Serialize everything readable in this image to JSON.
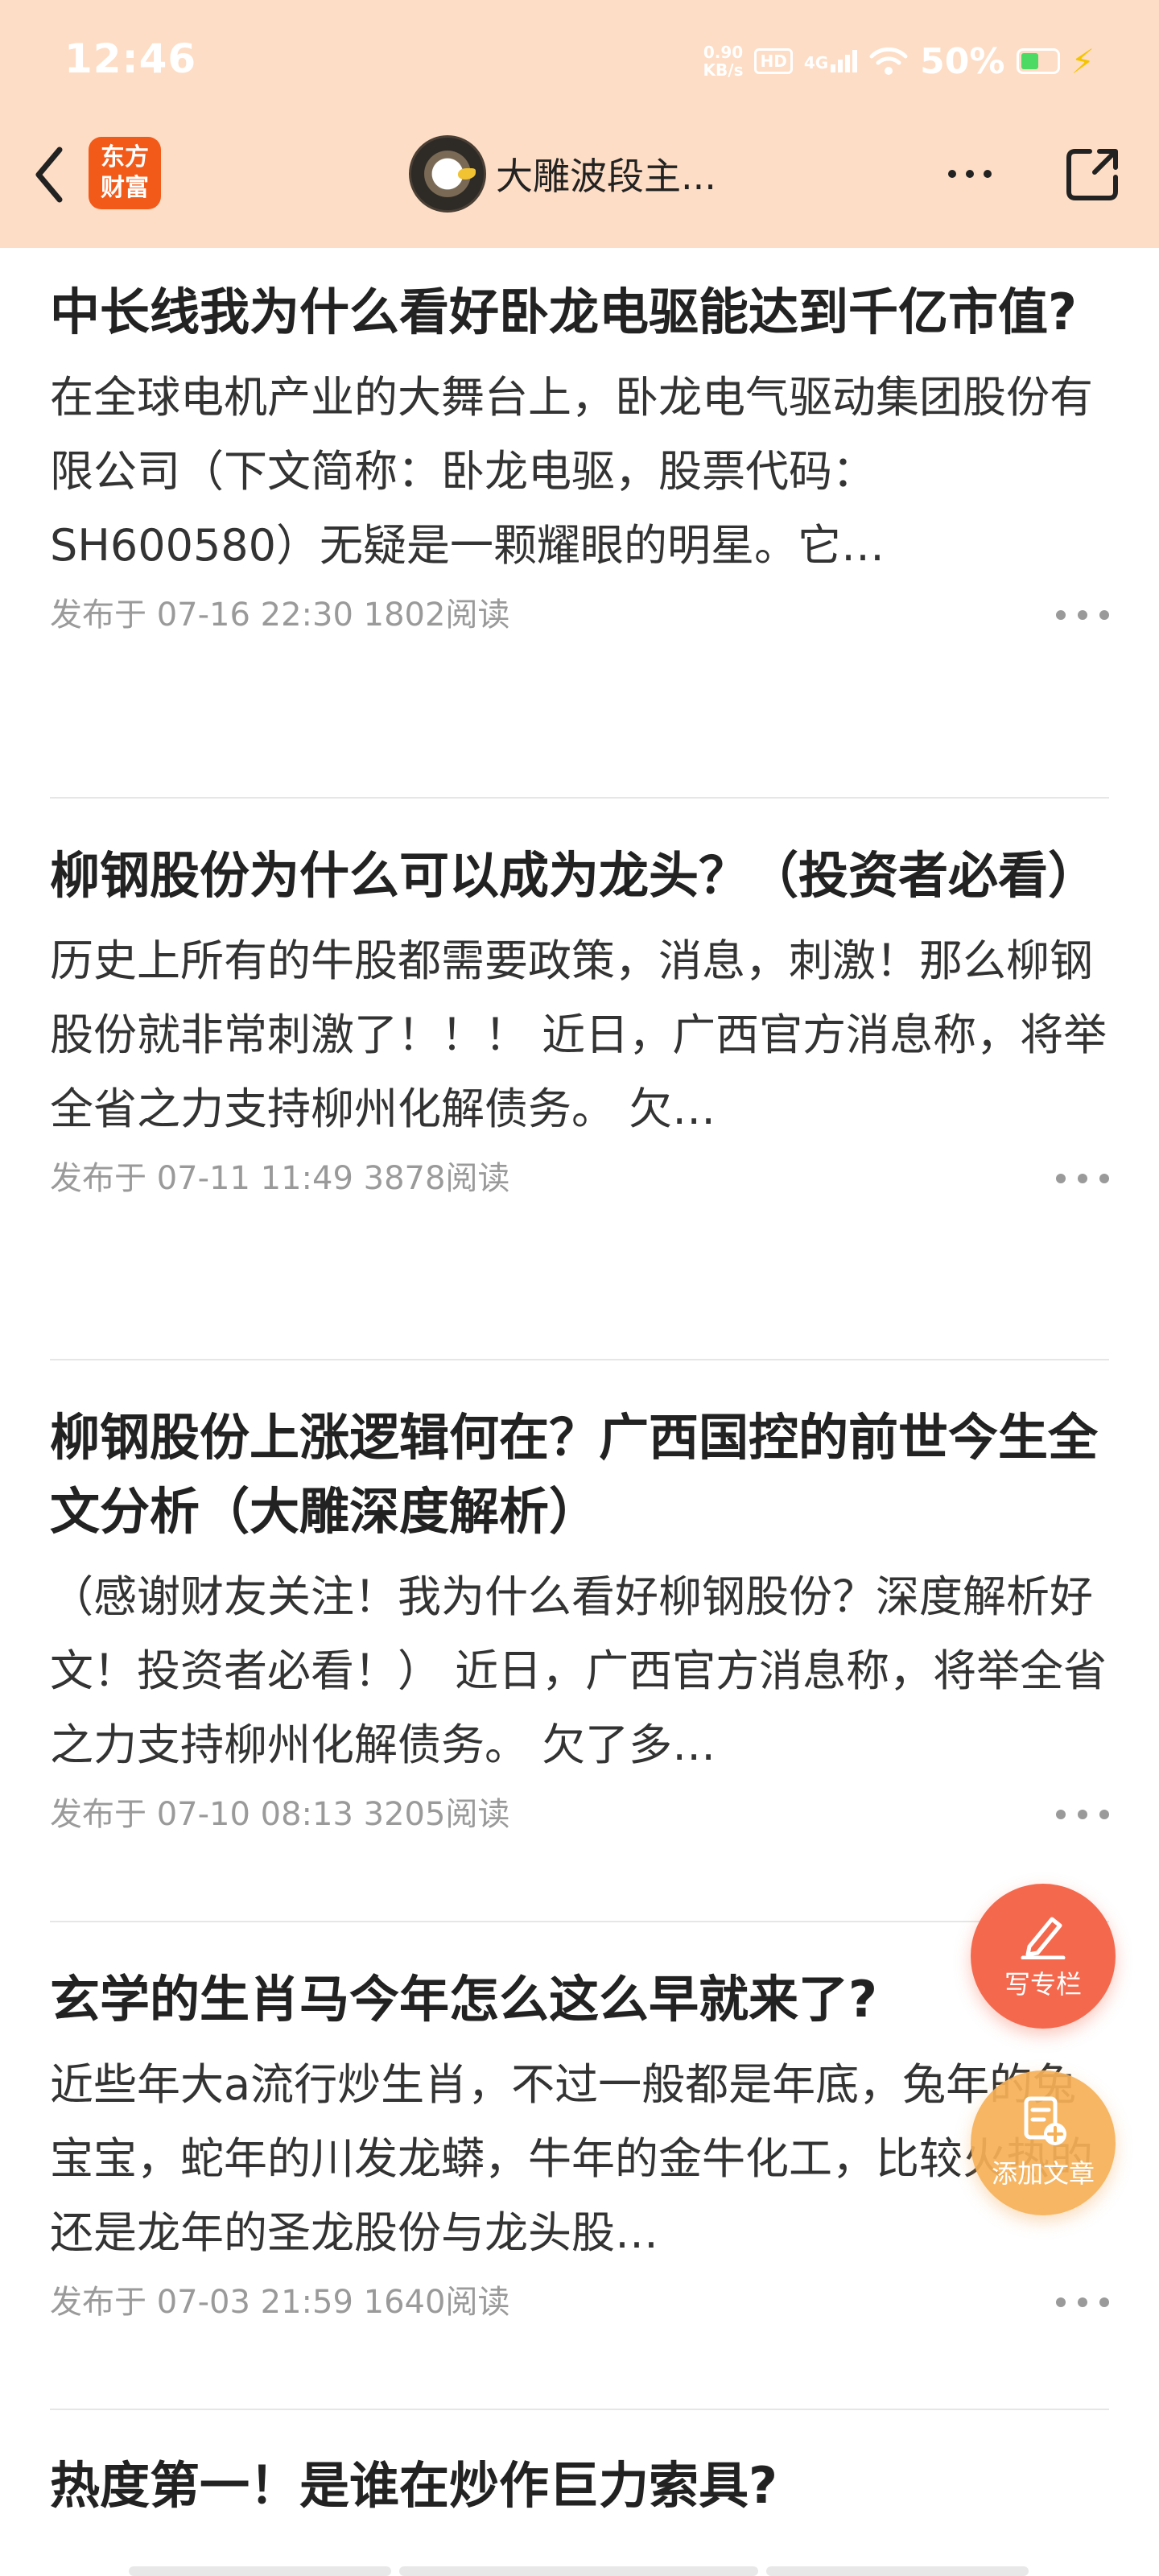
{
  "status_bar": {
    "time": "12:46",
    "net_speed_value": "0.90",
    "net_speed_unit": "KB/s",
    "hd_label": "HD",
    "network_label": "4G",
    "battery_percent": "50%"
  },
  "nav": {
    "logo_line1": "东方",
    "logo_line2": "财富",
    "author_name": "大雕波段主..."
  },
  "articles": [
    {
      "title": "中长线我为什么看好卧龙电驱能达到千亿市值?",
      "excerpt": "在全球电机产业的大舞台上，卧龙电气驱动集团股份有限公司（下文简称：卧龙电驱，股票代码：SH600580）无疑是一颗耀眼的明星。它…",
      "meta": "发布于 07-16 22:30 1802阅读"
    },
    {
      "title": "柳钢股份为什么可以成为龙头？（投资者必看）",
      "excerpt": "历史上所有的牛股都需要政策，消息，刺激！那么柳钢股份就非常刺激了！！！ 近日，广西官方消息称，将举全省之力支持柳州化解债务。 欠…",
      "meta": "发布于 07-11 11:49 3878阅读"
    },
    {
      "title": "柳钢股份上涨逻辑何在？广西国控的前世今生全文分析（大雕深度解析）",
      "excerpt": "（感谢财友关注！我为什么看好柳钢股份？深度解析好文！投资者必看！） 近日，广西官方消息称，将举全省之力支持柳州化解债务。 欠了多…",
      "meta": "发布于 07-10 08:13 3205阅读"
    },
    {
      "title": "玄学的生肖马今年怎么这么早就来了?",
      "excerpt": "近些年大a流行炒生肖，不过一般都是年底，兔年的兔宝宝，蛇年的川发龙蟒，牛年的金牛化工，比较火热的还是龙年的圣龙股份与龙头股…",
      "meta": "发布于 07-03 21:59 1640阅读"
    },
    {
      "title": "热度第一！是谁在炒作巨力索具?"
    }
  ],
  "fabs": {
    "write_label": "写专栏",
    "add_label": "添加文章"
  },
  "colors": {
    "header_bg": "#fdddc5",
    "brand_orange": "#f25a1a",
    "fab_write": "#f4694e",
    "fab_add": "#f6b056"
  }
}
